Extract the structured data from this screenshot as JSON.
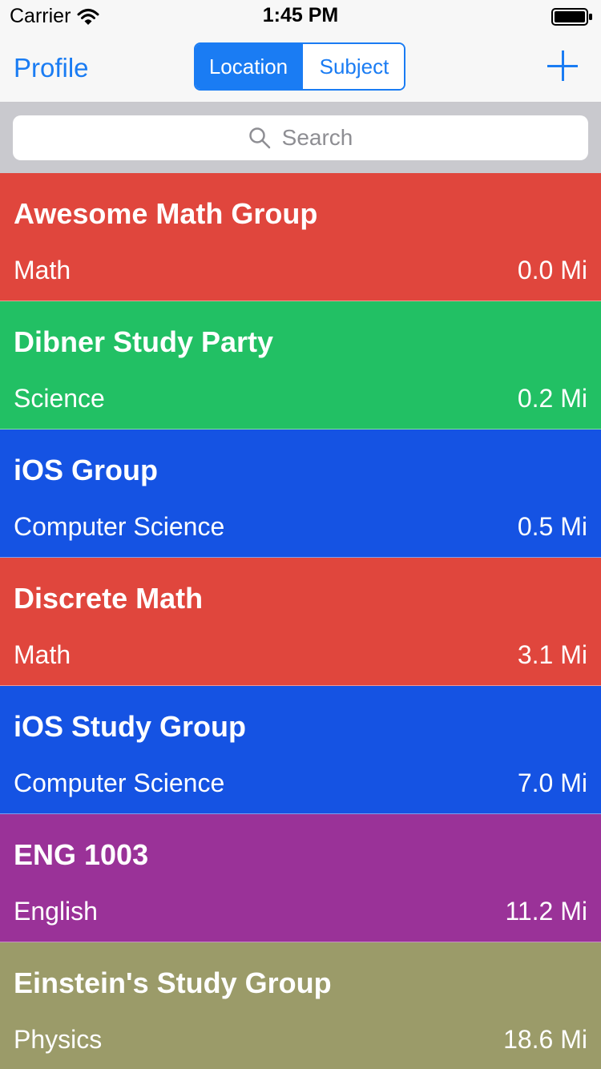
{
  "status_bar": {
    "carrier": "Carrier",
    "time": "1:45 PM",
    "wifi_icon": "wifi-icon",
    "battery_icon": "battery-icon"
  },
  "nav": {
    "left_label": "Profile",
    "segments": [
      {
        "label": "Location",
        "selected": true
      },
      {
        "label": "Subject",
        "selected": false
      }
    ],
    "add_icon": "plus-icon",
    "accent_color": "#1a7cf3"
  },
  "search": {
    "placeholder": "Search",
    "icon": "search-icon"
  },
  "groups": [
    {
      "title": "Awesome Math Group",
      "subject": "Math",
      "distance": "0.0 Mi",
      "color": "#e0463d"
    },
    {
      "title": "Dibner Study Party",
      "subject": "Science",
      "distance": "0.2 Mi",
      "color": "#22c064"
    },
    {
      "title": "iOS Group",
      "subject": "Computer Science",
      "distance": "0.5 Mi",
      "color": "#1553e3"
    },
    {
      "title": "Discrete Math",
      "subject": "Math",
      "distance": "3.1 Mi",
      "color": "#e0463d"
    },
    {
      "title": "iOS Study Group",
      "subject": "Computer Science",
      "distance": "7.0 Mi",
      "color": "#1553e3"
    },
    {
      "title": "ENG 1003",
      "subject": "English",
      "distance": "11.2 Mi",
      "color": "#9a3298"
    },
    {
      "title": "Einstein's Study Group",
      "subject": "Physics",
      "distance": "18.6 Mi",
      "color": "#9b9b69"
    }
  ]
}
